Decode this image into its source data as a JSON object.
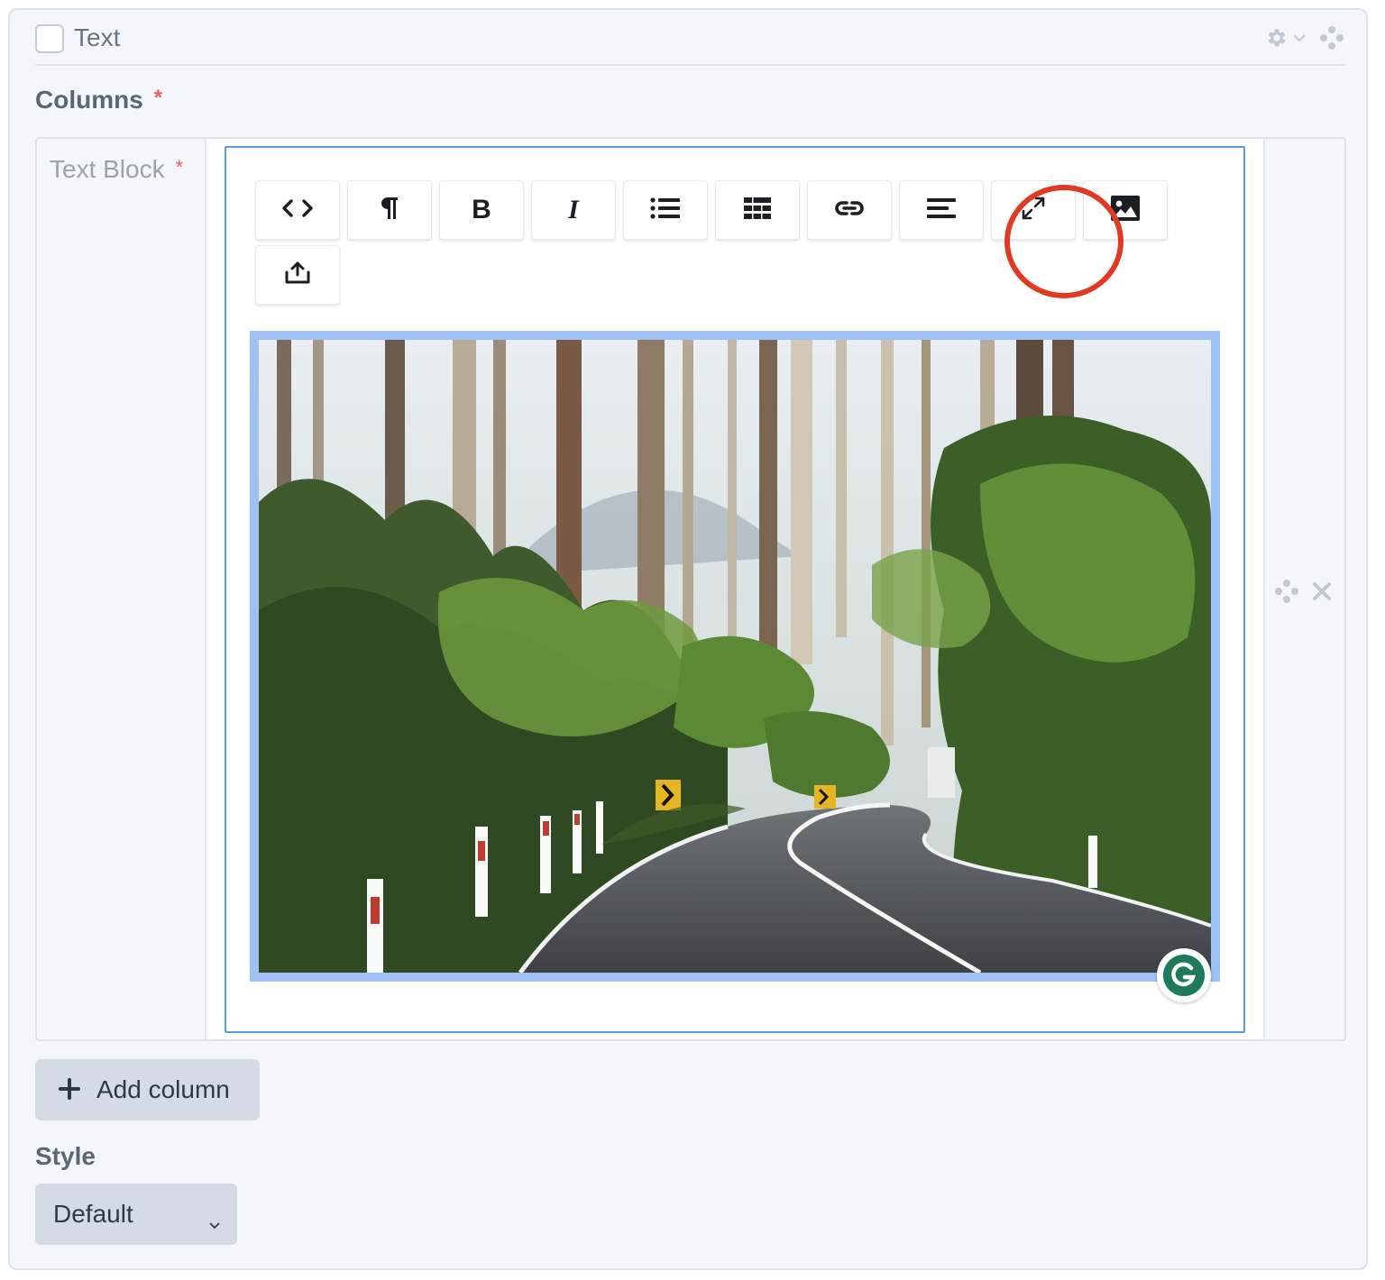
{
  "block": {
    "title": "Text",
    "icons": [
      "gear-icon",
      "chevron-down-icon",
      "move-handle-icon"
    ]
  },
  "columns_field": {
    "label": "Columns",
    "required_mark": "*",
    "column": {
      "label": "Text Block",
      "required_mark": "*",
      "row_icons": [
        "move-handle-icon",
        "close-icon"
      ]
    }
  },
  "toolbar": {
    "buttons": [
      {
        "name": "html-source",
        "glyph": "<>",
        "icon": "code-icon"
      },
      {
        "name": "formatting",
        "glyph": "¶",
        "icon": "paragraph-icon"
      },
      {
        "name": "bold",
        "glyph": "B",
        "icon": "bold-icon"
      },
      {
        "name": "italic",
        "glyph": "I",
        "icon": "italic-icon"
      },
      {
        "name": "unordered-list",
        "icon": "list-icon"
      },
      {
        "name": "table",
        "icon": "table-icon"
      },
      {
        "name": "link",
        "icon": "link-icon"
      },
      {
        "name": "alignment",
        "icon": "align-icon"
      },
      {
        "name": "fullscreen",
        "icon": "expand-icon"
      },
      {
        "name": "image",
        "icon": "image-icon"
      },
      {
        "name": "embed",
        "icon": "share-icon"
      }
    ],
    "highlighted_button": "fullscreen",
    "highlight_color": "#e23a22"
  },
  "editor": {
    "border_color": "#5b9be0",
    "image": {
      "description": "forest road",
      "frame_color": "#9ec1f5"
    },
    "badge_icon": "grammarly-icon"
  },
  "add_column": {
    "label": "Add column",
    "icon": "plus-icon"
  },
  "style_field": {
    "label": "Style",
    "selected": "Default"
  }
}
